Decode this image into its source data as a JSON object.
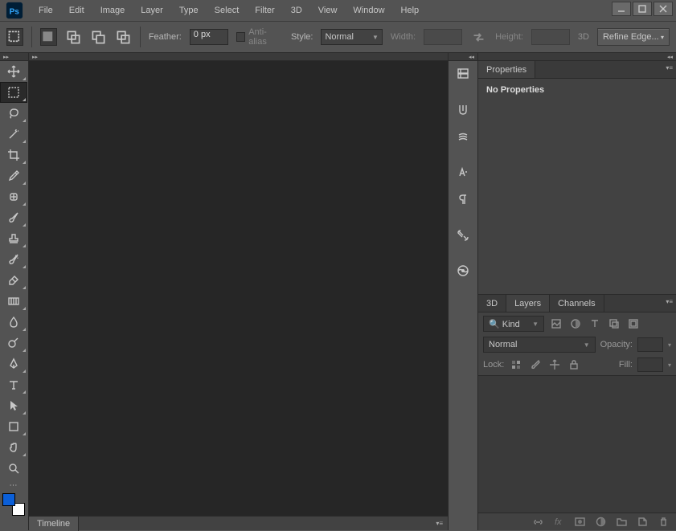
{
  "menu": [
    "File",
    "Edit",
    "Image",
    "Layer",
    "Type",
    "Select",
    "Filter",
    "3D",
    "View",
    "Window",
    "Help"
  ],
  "optbar": {
    "feather_label": "Feather:",
    "feather_value": "0 px",
    "antialias_label": "Anti-alias",
    "style_label": "Style:",
    "style_value": "Normal",
    "width_label": "Width:",
    "height_label": "Height:",
    "threed_label": "3D",
    "refine_label": "Refine Edge..."
  },
  "timeline": {
    "label": "Timeline"
  },
  "properties": {
    "tab": "Properties",
    "empty": "No Properties"
  },
  "layers": {
    "tabs": [
      "3D",
      "Layers",
      "Channels"
    ],
    "active_tab": 1,
    "kind_label": "Kind",
    "blend_value": "Normal",
    "opacity_label": "Opacity:",
    "lock_label": "Lock:",
    "fill_label": "Fill:"
  }
}
